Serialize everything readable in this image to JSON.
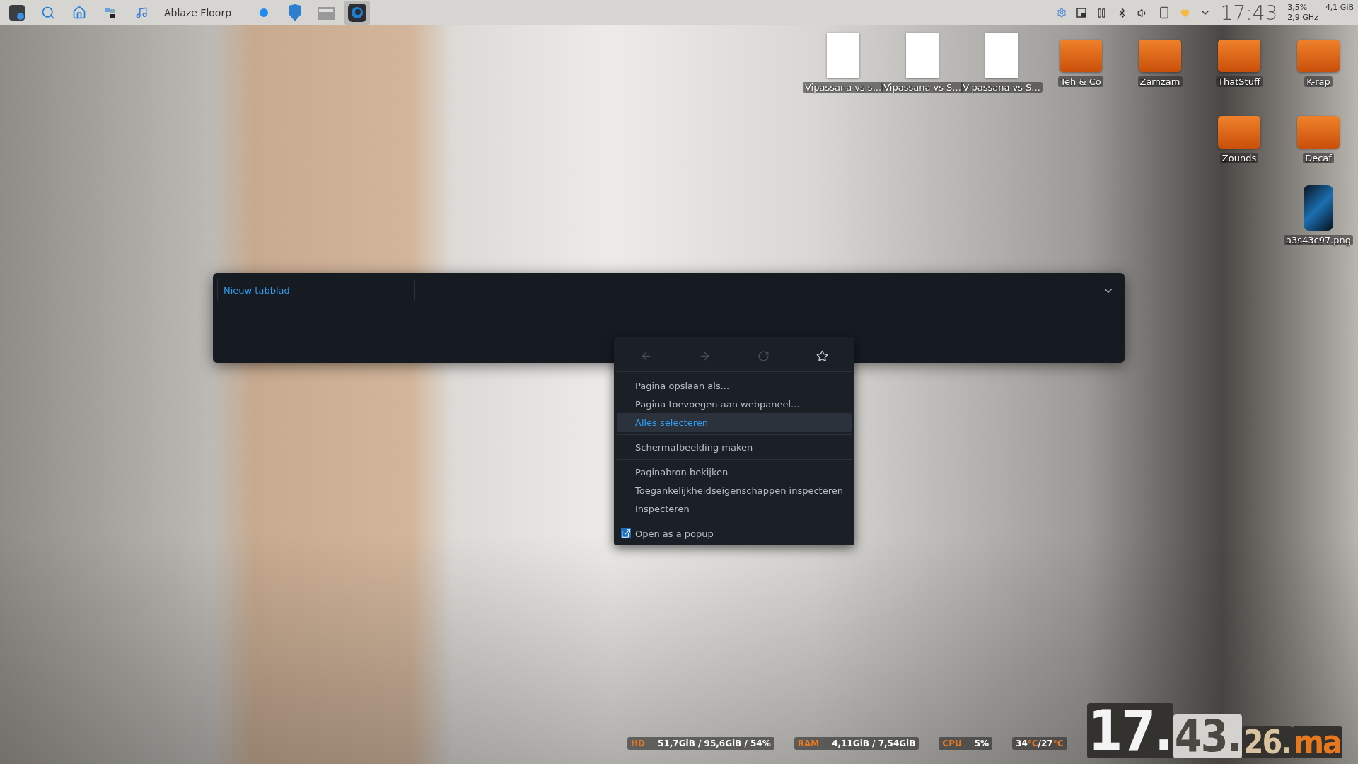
{
  "panel": {
    "launchers": [
      {
        "kind": "app"
      },
      {
        "kind": "search"
      },
      {
        "kind": "folder"
      },
      {
        "kind": "windows"
      },
      {
        "kind": "music"
      }
    ],
    "active_app": "Ablaze Floorp",
    "tasks": [
      {
        "kind": "dot",
        "selected": false
      },
      {
        "kind": "shield",
        "selected": false
      },
      {
        "kind": "files",
        "selected": false
      },
      {
        "kind": "browser",
        "selected": true
      }
    ],
    "tray": [
      {
        "kind": "gear"
      },
      {
        "kind": "window"
      },
      {
        "kind": "pause"
      },
      {
        "kind": "bluetooth"
      },
      {
        "kind": "volume"
      },
      {
        "kind": "phone"
      },
      {
        "kind": "heart"
      },
      {
        "kind": "chevron"
      }
    ],
    "clock": "17:43",
    "cpu": "3,5%",
    "memory": "4,1 GiB",
    "frequency": "2,9 GHz"
  },
  "desktop": {
    "columns": [
      [
        {
          "label": "Vipassana vs s...",
          "kind": "document"
        }
      ],
      [
        {
          "label": "Vipassana vs S...",
          "kind": "document"
        }
      ],
      [
        {
          "label": "Vipassana vs S...",
          "kind": "document"
        }
      ],
      [
        {
          "label": "Teh & Co",
          "kind": "folder"
        }
      ],
      [
        {
          "label": "Zamzam",
          "kind": "folder"
        }
      ],
      [
        {
          "label": "ThatStuff",
          "kind": "folder"
        },
        {
          "label": "Zounds",
          "kind": "folder"
        }
      ],
      [
        {
          "label": "K-rap",
          "kind": "folder"
        },
        {
          "label": "Decaf",
          "kind": "folder"
        },
        {
          "label": "a3s43c97.png",
          "kind": "image"
        }
      ]
    ]
  },
  "browser": {
    "tabs": [
      {
        "label": "Nieuw tabblad",
        "selected": true
      }
    ]
  },
  "context_menu": {
    "nav": [
      {
        "kind": "back",
        "disabled": true
      },
      {
        "kind": "forward",
        "disabled": true
      },
      {
        "kind": "reload",
        "disabled": true
      },
      {
        "kind": "bookmark",
        "disabled": false
      }
    ],
    "items": [
      {
        "kind": "item",
        "label": "Pagina opslaan als...",
        "selected": false
      },
      {
        "kind": "item",
        "label": "Pagina toevoegen aan webpaneel...",
        "selected": false
      },
      {
        "kind": "item",
        "label": "Alles selecteren",
        "selected": true
      },
      {
        "kind": "separator"
      },
      {
        "kind": "item",
        "label": "Schermafbeelding maken",
        "selected": false
      },
      {
        "kind": "separator"
      },
      {
        "kind": "item",
        "label": "Paginabron bekijken",
        "selected": false
      },
      {
        "kind": "item",
        "label": "Toegankelijkheidseigenschappen inspecteren",
        "selected": false
      },
      {
        "kind": "item",
        "label": "Inspecteren",
        "selected": false
      },
      {
        "kind": "separator"
      },
      {
        "kind": "extension",
        "label": "Open as a popup",
        "selected": false
      }
    ]
  },
  "system_monitor": {
    "stats": [
      {
        "label": "HD",
        "value": "51,7GiB / 95,6GiB / 54%"
      },
      {
        "label": "RAM",
        "value": "4,11GiB / 7,54GiB"
      },
      {
        "label": "CPU",
        "value": "5%"
      }
    ],
    "temperatures": [
      {
        "value": "34",
        "unit": "°C"
      },
      {
        "value": "/27",
        "unit": "°C"
      }
    ],
    "big_clock": [
      {
        "text": "17.",
        "kind": "hours"
      },
      {
        "text": "43.",
        "kind": "minutes"
      },
      {
        "text": "26.",
        "kind": "seconds"
      },
      {
        "text": "ma",
        "kind": "weekday"
      }
    ]
  }
}
